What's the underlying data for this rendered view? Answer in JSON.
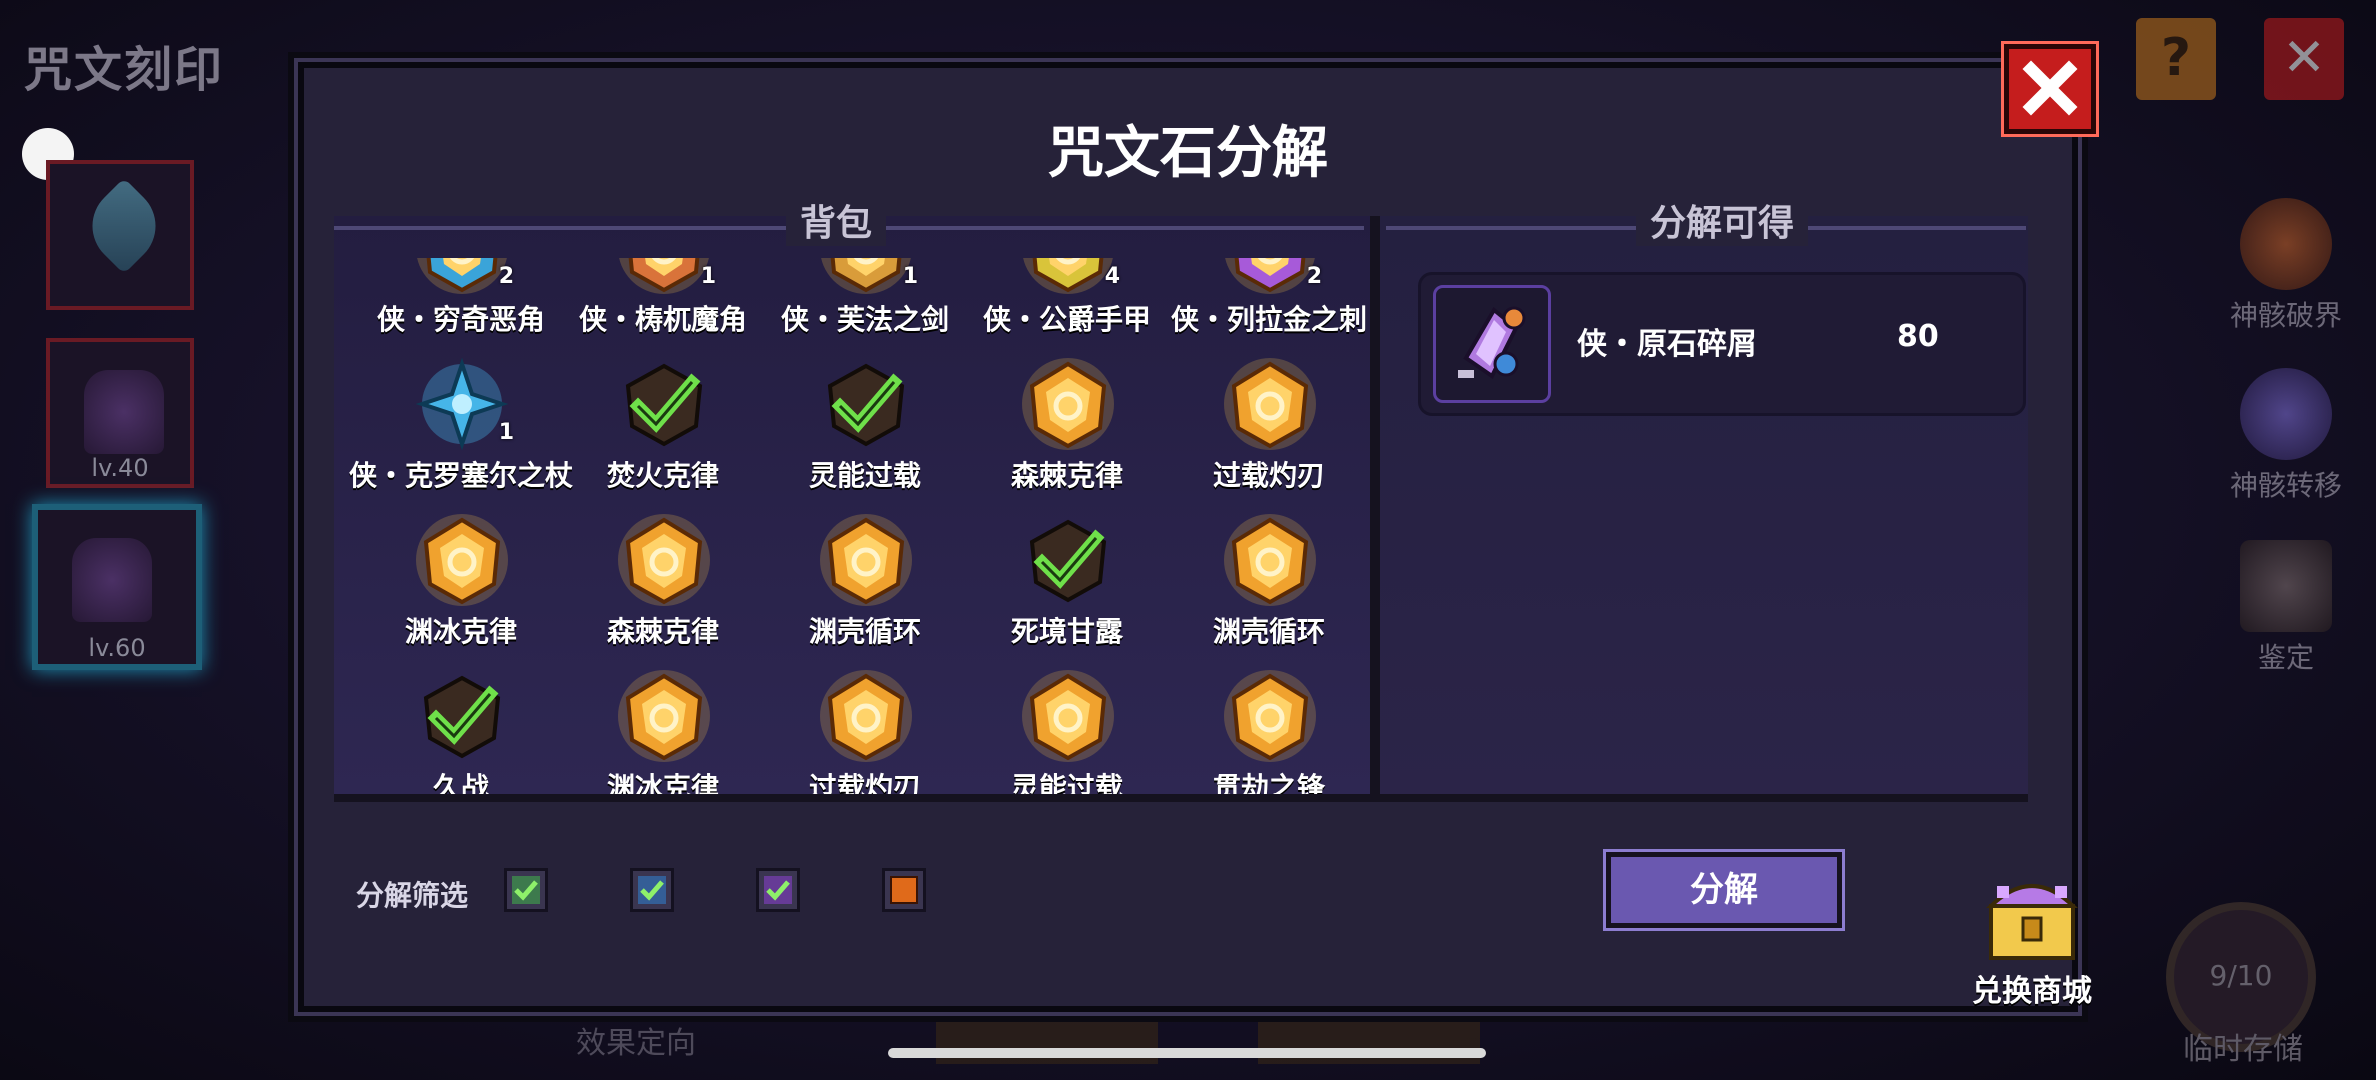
{
  "background": {
    "page_title": "咒文刻印",
    "left_slots": [
      {
        "level": ""
      },
      {
        "level": "lv.40"
      },
      {
        "level": "lv.60"
      }
    ],
    "right_menu": [
      {
        "label": "神骸破界",
        "icon": "skull-orb-icon"
      },
      {
        "label": "神骸转移",
        "icon": "orb-icon"
      },
      {
        "label": "鉴定",
        "icon": "anvil-icon"
      }
    ],
    "storage": {
      "value": "9/10",
      "label": "临时存储"
    },
    "bottom_text": "效果定向",
    "help_glyph": "?",
    "close_glyph": "✕"
  },
  "modal": {
    "title": "咒文石分解",
    "backpack_header": "背包",
    "result_header": "分解可得",
    "items": [
      {
        "name": "侠・穷奇恶角",
        "count": "2",
        "state": "partial",
        "color": "#3aa4d9"
      },
      {
        "name": "侠・梼杌魔角",
        "count": "1",
        "state": "partial",
        "color": "#d9733a"
      },
      {
        "name": "侠・芙法之剑",
        "count": "1",
        "state": "partial",
        "color": "#d99c3a"
      },
      {
        "name": "侠・公爵手甲",
        "count": "4",
        "state": "partial",
        "color": "#d9c43a"
      },
      {
        "name": "侠・列拉金之刺",
        "count": "2",
        "state": "partial",
        "color": "#a75ad9"
      },
      {
        "name": "侠・克罗塞尔之杖",
        "count": "1",
        "state": "blue",
        "color": "#46b5e8"
      },
      {
        "name": "焚火克律",
        "count": "",
        "state": "checked",
        "color": "#e89a2a"
      },
      {
        "name": "灵能过载",
        "count": "",
        "state": "checked",
        "color": "#e89a2a"
      },
      {
        "name": "森棘克律",
        "count": "",
        "state": "gem",
        "color": "#f0a22e"
      },
      {
        "name": "过载灼刃",
        "count": "",
        "state": "gem",
        "color": "#f0a22e"
      },
      {
        "name": "渊冰克律",
        "count": "",
        "state": "gem",
        "color": "#f0a22e"
      },
      {
        "name": "森棘克律",
        "count": "",
        "state": "gem",
        "color": "#f0a22e"
      },
      {
        "name": "渊壳循环",
        "count": "",
        "state": "gem",
        "color": "#f0a22e"
      },
      {
        "name": "死境甘露",
        "count": "",
        "state": "checked",
        "color": "#f0a22e"
      },
      {
        "name": "渊壳循环",
        "count": "",
        "state": "gem",
        "color": "#f0a22e"
      },
      {
        "name": "久战",
        "count": "",
        "state": "checked",
        "color": "#f0a22e"
      },
      {
        "name": "渊冰克律",
        "count": "",
        "state": "gem",
        "color": "#f0a22e"
      },
      {
        "name": "过载灼刃",
        "count": "",
        "state": "gem",
        "color": "#f0a22e"
      },
      {
        "name": "灵能过载",
        "count": "",
        "state": "gem",
        "color": "#f0a22e"
      },
      {
        "name": "贯劫之锋",
        "count": "",
        "state": "gem",
        "color": "#f0a22e"
      }
    ],
    "result": {
      "name": "侠・原石碎屑",
      "quantity": "80"
    },
    "filter": {
      "label": "分解筛选",
      "options": [
        {
          "color": "#3fb24a",
          "checked": true
        },
        {
          "color": "#2f7fd0",
          "checked": true
        },
        {
          "color": "#8a3fd0",
          "checked": true
        },
        {
          "color": "#e06a1a",
          "checked": false
        }
      ]
    },
    "decompose_button": "分解",
    "shop_label": "兑换商城",
    "close_glyph": "✕"
  },
  "colors": {
    "modal_bg": "#262239",
    "accent_purple": "#6a58b0",
    "close_red": "#c51d1d"
  }
}
